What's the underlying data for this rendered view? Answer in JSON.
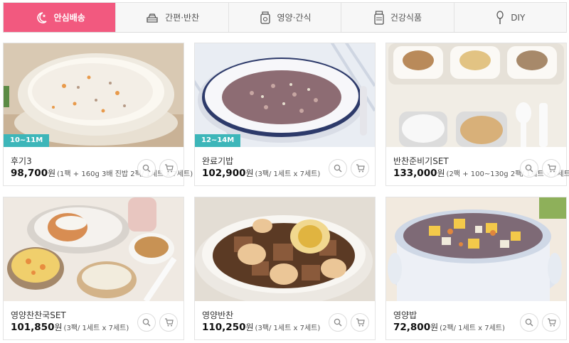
{
  "tabs": [
    {
      "label": "안심배송",
      "icon": "moon-star-icon",
      "active": true
    },
    {
      "label": "간편·반찬",
      "icon": "bento-icon",
      "active": false
    },
    {
      "label": "영양·간식",
      "icon": "jar-icon",
      "active": false
    },
    {
      "label": "건강식품",
      "icon": "supplement-bottle-icon",
      "active": false
    },
    {
      "label": "DIY",
      "icon": "spoon-icon",
      "active": false
    }
  ],
  "products": [
    {
      "name": "후기3",
      "price": "98,700",
      "currency": "원",
      "detail": "(1팩 + 160g 3배 진밥 2팩/ 1세트 x 7세트)",
      "age": "10~11M"
    },
    {
      "name": "완료기밥",
      "price": "102,900",
      "currency": "원",
      "detail": "(3팩/ 1세트 x 7세트)",
      "age": "12~14M"
    },
    {
      "name": "반찬준비기SET",
      "price": "133,000",
      "currency": "원",
      "detail": "(2팩 + 100~130g 2팩/ 1세트 x 7세트)",
      "age": ""
    },
    {
      "name": "영양찬찬국SET",
      "price": "101,850",
      "currency": "원",
      "detail": "(3팩/ 1세트 x 7세트)",
      "age": ""
    },
    {
      "name": "영양반찬",
      "price": "110,250",
      "currency": "원",
      "detail": "(3팩/ 1세트 x 7세트)",
      "age": ""
    },
    {
      "name": "영양밥",
      "price": "72,800",
      "currency": "원",
      "detail": "(2팩/ 1세트 x 7세트)",
      "age": ""
    }
  ],
  "colors": {
    "accent": "#f2597f",
    "age_badge": "#3db6b9"
  }
}
